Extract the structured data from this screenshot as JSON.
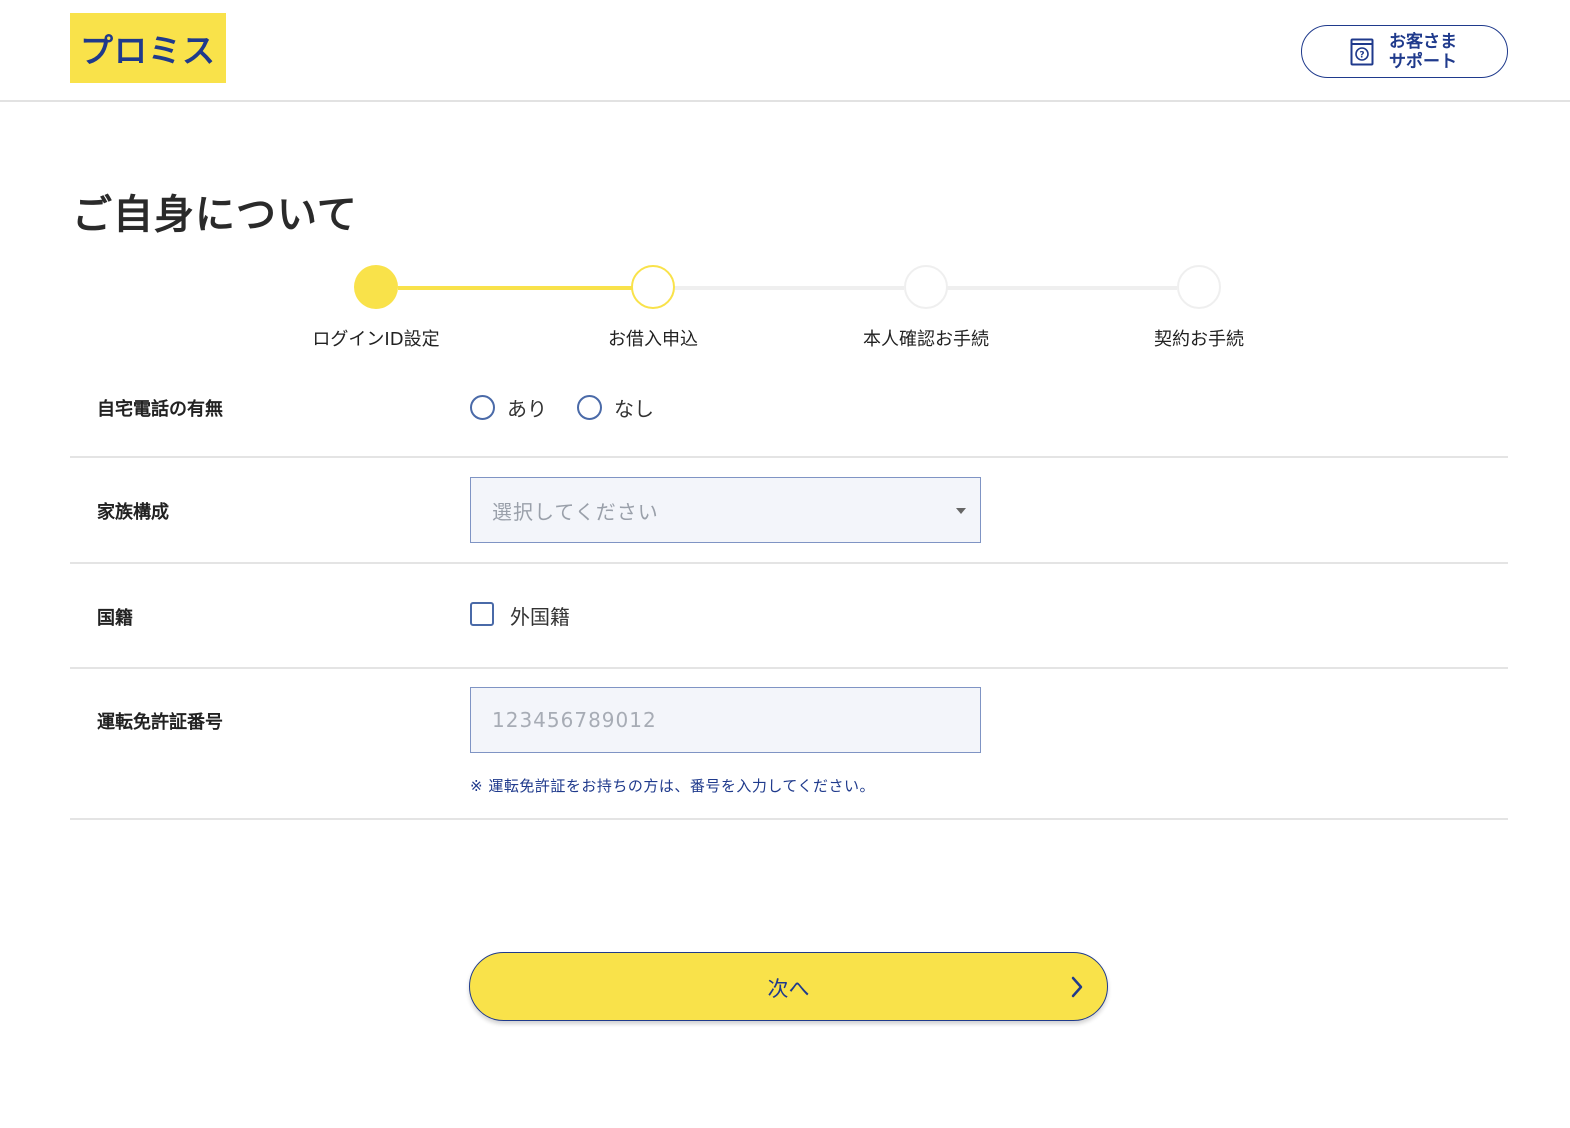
{
  "header": {
    "logo_text": "プロミス",
    "support": {
      "line1": "お客さま",
      "line2": "サポート",
      "icon": "support-book-icon"
    }
  },
  "page": {
    "title": "ご自身について"
  },
  "stepper": {
    "steps": [
      {
        "label": "ログインID設定",
        "state": "done"
      },
      {
        "label": "お借入申込",
        "state": "current"
      },
      {
        "label": "本人確認お手続",
        "state": "todo"
      },
      {
        "label": "契約お手続",
        "state": "todo"
      }
    ]
  },
  "form": {
    "home_phone": {
      "label": "自宅電話の有無",
      "options": [
        "あり",
        "なし"
      ]
    },
    "family": {
      "label": "家族構成",
      "placeholder": "選択してください"
    },
    "nationality": {
      "label": "国籍",
      "checkbox_label": "外国籍"
    },
    "license": {
      "label": "運転免許証番号",
      "placeholder": "123456789012",
      "note": "※ 運転免許証をお持ちの方は、番号を入力してください。"
    }
  },
  "actions": {
    "next_label": "次へ"
  },
  "colors": {
    "brand_yellow": "#f9e24a",
    "brand_navy": "#1f3a8c",
    "field_bg": "#f3f5fa"
  }
}
